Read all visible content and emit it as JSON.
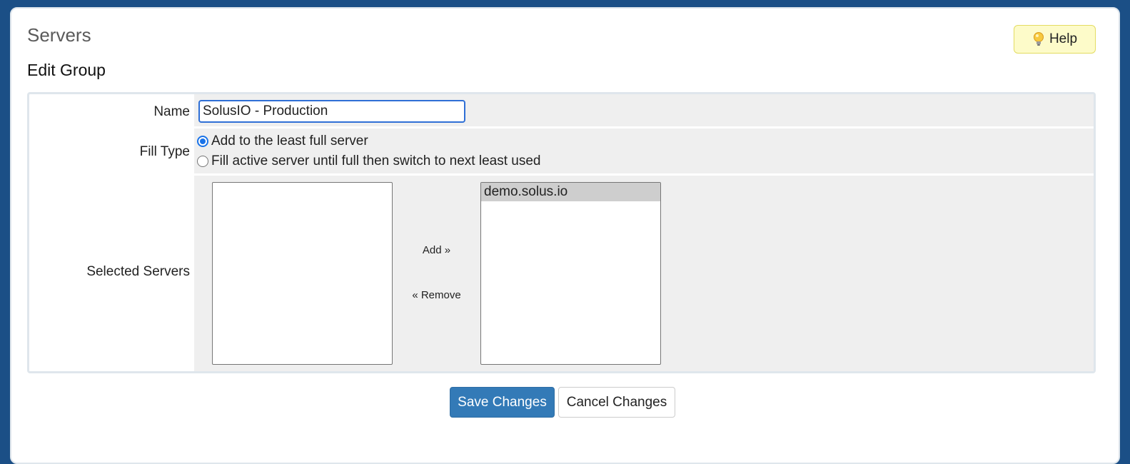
{
  "page": {
    "title": "Servers",
    "section_title": "Edit Group"
  },
  "help_button": {
    "label": "Help",
    "icon": "lightbulb-icon"
  },
  "form": {
    "name": {
      "label": "Name",
      "value": "SolusIO - Production"
    },
    "fill_type": {
      "label": "Fill Type",
      "options": [
        {
          "label": "Add to the least full server",
          "checked": true
        },
        {
          "label": "Fill active server until full then switch to next least used",
          "checked": false
        }
      ]
    },
    "selected_servers": {
      "label": "Selected Servers",
      "available": [],
      "selected": [
        "demo.solus.io"
      ],
      "add_label": "Add »",
      "remove_label": "« Remove"
    }
  },
  "actions": {
    "save_label": "Save Changes",
    "cancel_label": "Cancel Changes"
  },
  "colors": {
    "background": "#1b4f86",
    "primary_button": "#337ab7",
    "help_button": "#fdfbc9",
    "field_background": "#efefef",
    "radio_accent": "#1a73e8"
  }
}
